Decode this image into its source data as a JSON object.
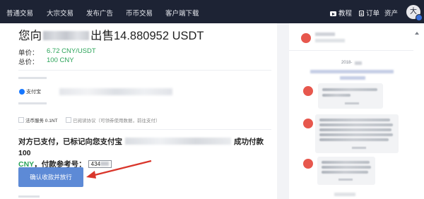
{
  "nav": {
    "items": [
      "普通交易",
      "大宗交易",
      "发布广告",
      "币币交易",
      "客户端下载"
    ],
    "tutorial_label": "教程",
    "orders_label": "订单",
    "assets_label": "资产",
    "avatar_letter": "大"
  },
  "order": {
    "headline_prefix": "您向",
    "headline_suffix": "出售14.880952 USDT",
    "price_label": "单价：",
    "price_value": "6.72 CNY/USDT",
    "total_label": "总价：",
    "total_value": "100 CNY",
    "pay_method_name": "支付宝",
    "fee_label": "法币服务 0.1NT",
    "agreement_label": "已阅读协议（可领券使用数据，前往支付）",
    "notice_part1": "对方已支付，已标记向您支付宝",
    "notice_part2": "成功付款100",
    "notice_part3": "CNY",
    "notice_part4": "，付款参考号：",
    "ref_prefix": "434",
    "confirm_button": "确认收款并放行"
  },
  "chat": {
    "date": "2018-"
  },
  "colors": {
    "nav_bg": "#1d2334",
    "accent_green": "#2ca45a",
    "button_blue": "#5d8ad6",
    "arrow_red": "#d9362b",
    "chat_avatar": "#e7574d"
  }
}
